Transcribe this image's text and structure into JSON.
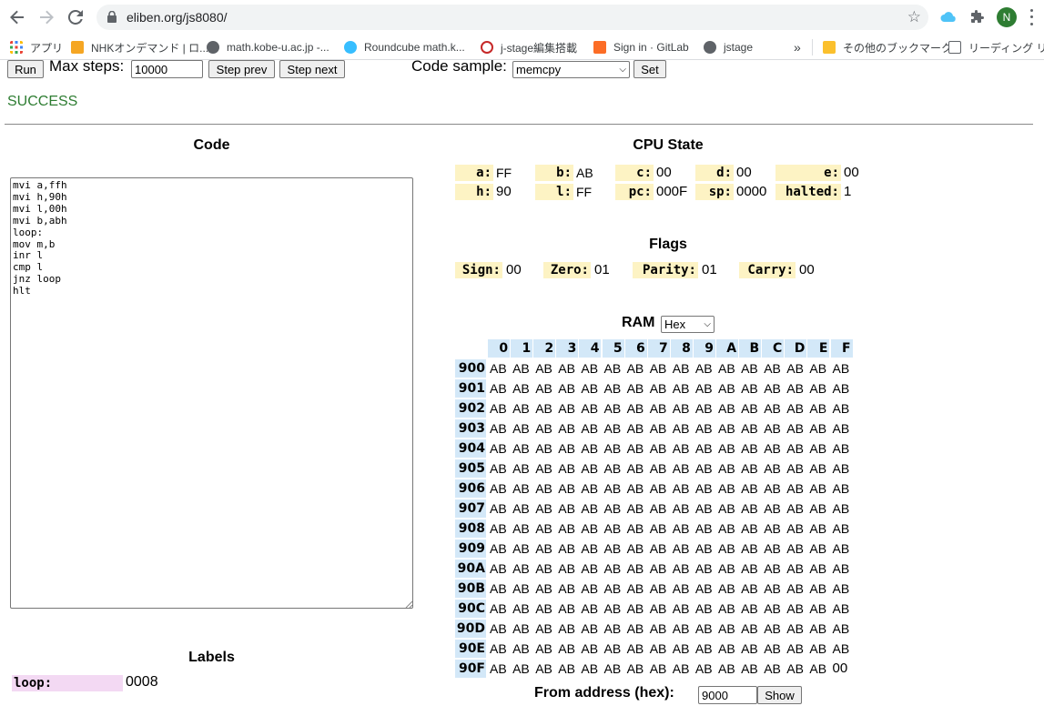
{
  "browser": {
    "url": "eliben.org/js8080/",
    "profile_initial": "N",
    "bookmarks": [
      {
        "label": "アプリ",
        "icon": "apps-grid-icon"
      },
      {
        "label": "NHKオンデマンド | ロ...",
        "icon": "nhk-icon"
      },
      {
        "label": "math.kobe-u.ac.jp -...",
        "icon": "globe-icon"
      },
      {
        "label": "Roundcube math.k...",
        "icon": "roundcube-icon"
      },
      {
        "label": "j-stage編集搭載",
        "icon": "jstage-icon"
      },
      {
        "label": "Sign in · GitLab",
        "icon": "gitlab-icon"
      },
      {
        "label": "jstage",
        "icon": "globe-icon"
      }
    ],
    "overflow_label": "»",
    "other_bookmarks": "その他のブックマーク",
    "reading_list": "リーディング リスト"
  },
  "controls": {
    "run_label": "Run",
    "max_steps_label": "Max steps:",
    "max_steps_value": "10000",
    "step_prev_label": "Step prev",
    "step_next_label": "Step next",
    "code_sample_label": "Code sample:",
    "code_sample_value": "memcpy",
    "set_label": "Set"
  },
  "status": "SUCCESS",
  "code": {
    "title": "Code",
    "source": "mvi a,ffh\nmvi h,90h\nmvi l,00h\nmvi b,abh\nloop:\nmov m,b\ninr l\ncmp l\njnz loop\nhlt"
  },
  "labels": {
    "title": "Labels",
    "items": [
      {
        "name": "loop:",
        "value": "0008"
      }
    ]
  },
  "cpu": {
    "title": "CPU State",
    "registers": [
      {
        "name": "a:",
        "value": "FF"
      },
      {
        "name": "b:",
        "value": "AB"
      },
      {
        "name": "c:",
        "value": "00"
      },
      {
        "name": "d:",
        "value": "00"
      },
      {
        "name": "e:",
        "value": "00"
      },
      {
        "name": "h:",
        "value": "90"
      },
      {
        "name": "l:",
        "value": "FF"
      },
      {
        "name": "pc:",
        "value": "000F"
      },
      {
        "name": "sp:",
        "value": "0000"
      },
      {
        "name": "halted:",
        "value": "1"
      }
    ]
  },
  "flags": {
    "title": "Flags",
    "items": [
      {
        "name": "Sign:",
        "value": "00"
      },
      {
        "name": "Zero:",
        "value": "01"
      },
      {
        "name": "Parity:",
        "value": "01"
      },
      {
        "name": "Carry:",
        "value": "00"
      }
    ]
  },
  "ram": {
    "title": "RAM",
    "format_value": "Hex",
    "columns": [
      "0",
      "1",
      "2",
      "3",
      "4",
      "5",
      "6",
      "7",
      "8",
      "9",
      "A",
      "B",
      "C",
      "D",
      "E",
      "F"
    ],
    "rows": [
      {
        "addr": "900",
        "cells": [
          "AB",
          "AB",
          "AB",
          "AB",
          "AB",
          "AB",
          "AB",
          "AB",
          "AB",
          "AB",
          "AB",
          "AB",
          "AB",
          "AB",
          "AB",
          "AB"
        ]
      },
      {
        "addr": "901",
        "cells": [
          "AB",
          "AB",
          "AB",
          "AB",
          "AB",
          "AB",
          "AB",
          "AB",
          "AB",
          "AB",
          "AB",
          "AB",
          "AB",
          "AB",
          "AB",
          "AB"
        ]
      },
      {
        "addr": "902",
        "cells": [
          "AB",
          "AB",
          "AB",
          "AB",
          "AB",
          "AB",
          "AB",
          "AB",
          "AB",
          "AB",
          "AB",
          "AB",
          "AB",
          "AB",
          "AB",
          "AB"
        ]
      },
      {
        "addr": "903",
        "cells": [
          "AB",
          "AB",
          "AB",
          "AB",
          "AB",
          "AB",
          "AB",
          "AB",
          "AB",
          "AB",
          "AB",
          "AB",
          "AB",
          "AB",
          "AB",
          "AB"
        ]
      },
      {
        "addr": "904",
        "cells": [
          "AB",
          "AB",
          "AB",
          "AB",
          "AB",
          "AB",
          "AB",
          "AB",
          "AB",
          "AB",
          "AB",
          "AB",
          "AB",
          "AB",
          "AB",
          "AB"
        ]
      },
      {
        "addr": "905",
        "cells": [
          "AB",
          "AB",
          "AB",
          "AB",
          "AB",
          "AB",
          "AB",
          "AB",
          "AB",
          "AB",
          "AB",
          "AB",
          "AB",
          "AB",
          "AB",
          "AB"
        ]
      },
      {
        "addr": "906",
        "cells": [
          "AB",
          "AB",
          "AB",
          "AB",
          "AB",
          "AB",
          "AB",
          "AB",
          "AB",
          "AB",
          "AB",
          "AB",
          "AB",
          "AB",
          "AB",
          "AB"
        ]
      },
      {
        "addr": "907",
        "cells": [
          "AB",
          "AB",
          "AB",
          "AB",
          "AB",
          "AB",
          "AB",
          "AB",
          "AB",
          "AB",
          "AB",
          "AB",
          "AB",
          "AB",
          "AB",
          "AB"
        ]
      },
      {
        "addr": "908",
        "cells": [
          "AB",
          "AB",
          "AB",
          "AB",
          "AB",
          "AB",
          "AB",
          "AB",
          "AB",
          "AB",
          "AB",
          "AB",
          "AB",
          "AB",
          "AB",
          "AB"
        ]
      },
      {
        "addr": "909",
        "cells": [
          "AB",
          "AB",
          "AB",
          "AB",
          "AB",
          "AB",
          "AB",
          "AB",
          "AB",
          "AB",
          "AB",
          "AB",
          "AB",
          "AB",
          "AB",
          "AB"
        ]
      },
      {
        "addr": "90A",
        "cells": [
          "AB",
          "AB",
          "AB",
          "AB",
          "AB",
          "AB",
          "AB",
          "AB",
          "AB",
          "AB",
          "AB",
          "AB",
          "AB",
          "AB",
          "AB",
          "AB"
        ]
      },
      {
        "addr": "90B",
        "cells": [
          "AB",
          "AB",
          "AB",
          "AB",
          "AB",
          "AB",
          "AB",
          "AB",
          "AB",
          "AB",
          "AB",
          "AB",
          "AB",
          "AB",
          "AB",
          "AB"
        ]
      },
      {
        "addr": "90C",
        "cells": [
          "AB",
          "AB",
          "AB",
          "AB",
          "AB",
          "AB",
          "AB",
          "AB",
          "AB",
          "AB",
          "AB",
          "AB",
          "AB",
          "AB",
          "AB",
          "AB"
        ]
      },
      {
        "addr": "90D",
        "cells": [
          "AB",
          "AB",
          "AB",
          "AB",
          "AB",
          "AB",
          "AB",
          "AB",
          "AB",
          "AB",
          "AB",
          "AB",
          "AB",
          "AB",
          "AB",
          "AB"
        ]
      },
      {
        "addr": "90E",
        "cells": [
          "AB",
          "AB",
          "AB",
          "AB",
          "AB",
          "AB",
          "AB",
          "AB",
          "AB",
          "AB",
          "AB",
          "AB",
          "AB",
          "AB",
          "AB",
          "AB"
        ]
      },
      {
        "addr": "90F",
        "cells": [
          "AB",
          "AB",
          "AB",
          "AB",
          "AB",
          "AB",
          "AB",
          "AB",
          "AB",
          "AB",
          "AB",
          "AB",
          "AB",
          "AB",
          "AB",
          "00"
        ]
      }
    ],
    "from_address_label": "From address (hex):",
    "from_address_value": "9000",
    "show_label": "Show"
  }
}
